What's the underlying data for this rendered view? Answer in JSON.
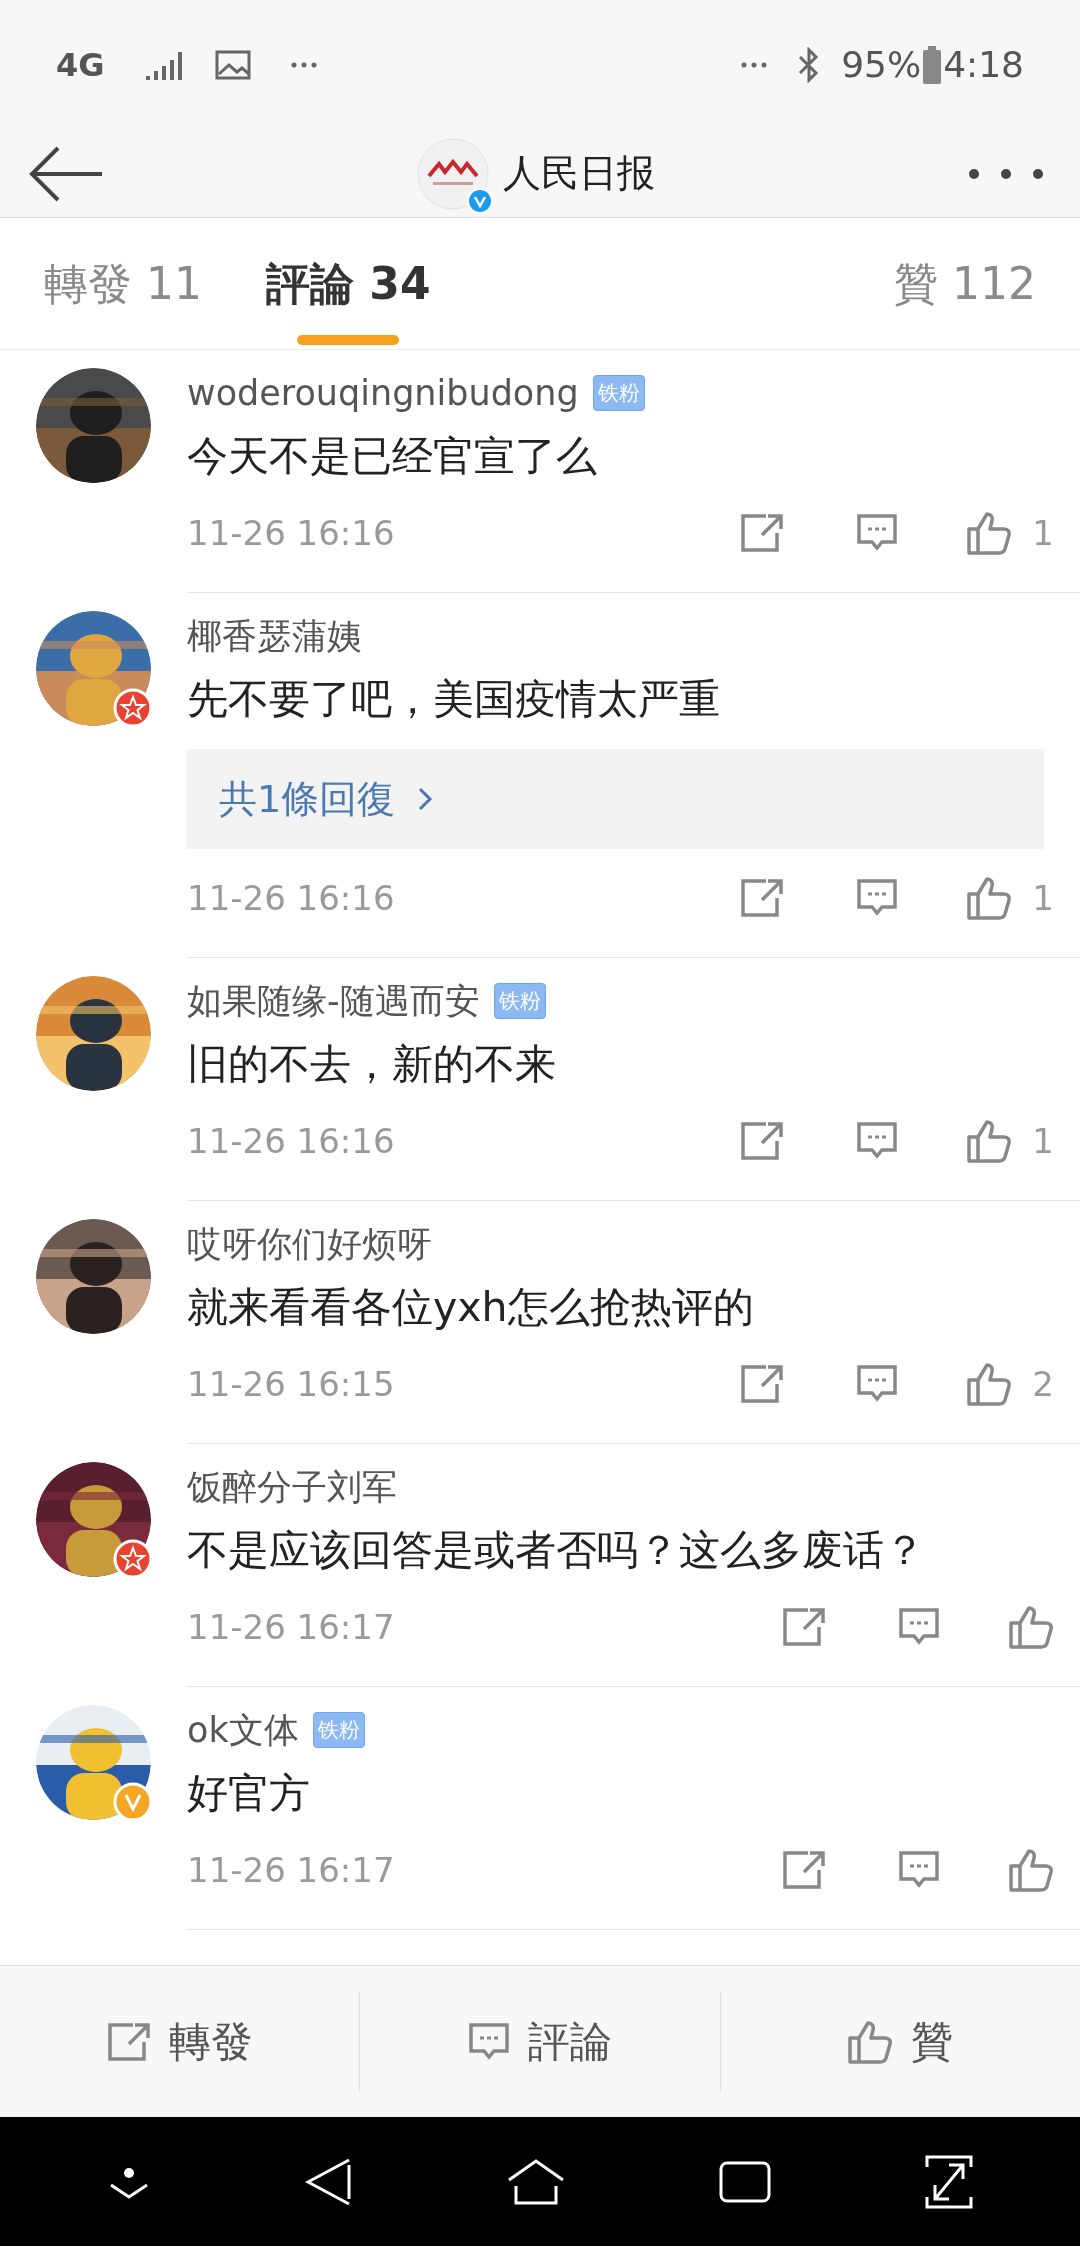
{
  "status_bar": {
    "network": "4G",
    "battery": "95%",
    "time": "4:18"
  },
  "header": {
    "title": "人民日报",
    "verified": true
  },
  "tabs": [
    {
      "label": "轉發 11",
      "selected": false
    },
    {
      "label": "評論 34",
      "selected": true
    },
    {
      "label": "贊 112",
      "selected": false
    }
  ],
  "comments": [
    {
      "user": "woderouqingnibudong",
      "badge": "铁粉",
      "star_badge": false,
      "verified": false,
      "text": "今天不是已经官宣了么",
      "time": "11-26 16:16",
      "likes": "1"
    },
    {
      "user": "椰香瑟蒲姨",
      "star_badge": true,
      "verified": false,
      "text": "先不要了吧，美国疫情太严重",
      "replies": "共1條回復",
      "time": "11-26 16:16",
      "likes": "1"
    },
    {
      "user": "如果随缘-随遇而安",
      "badge": "铁粉",
      "star_badge": false,
      "verified": false,
      "text": "旧的不去，新的不来",
      "time": "11-26 16:16",
      "likes": "1"
    },
    {
      "user": "哎呀你们好烦呀",
      "star_badge": false,
      "verified": false,
      "text": "就来看看各位yxh怎么抢热评的",
      "time": "11-26 16:15",
      "likes": "2"
    },
    {
      "user": "饭醉分子刘军",
      "star_badge": true,
      "verified": false,
      "text": "不是应该回答是或者否吗？这么多废话？",
      "time": "11-26 16:17"
    },
    {
      "user": "ok文体",
      "badge": "铁粉",
      "star_badge": false,
      "verified": true,
      "text": "好官方",
      "time": "11-26 16:17"
    }
  ],
  "bottom_bar": [
    {
      "kind": "share",
      "label": "轉發"
    },
    {
      "kind": "comment",
      "label": "評論"
    },
    {
      "kind": "like",
      "label": "贊"
    }
  ]
}
